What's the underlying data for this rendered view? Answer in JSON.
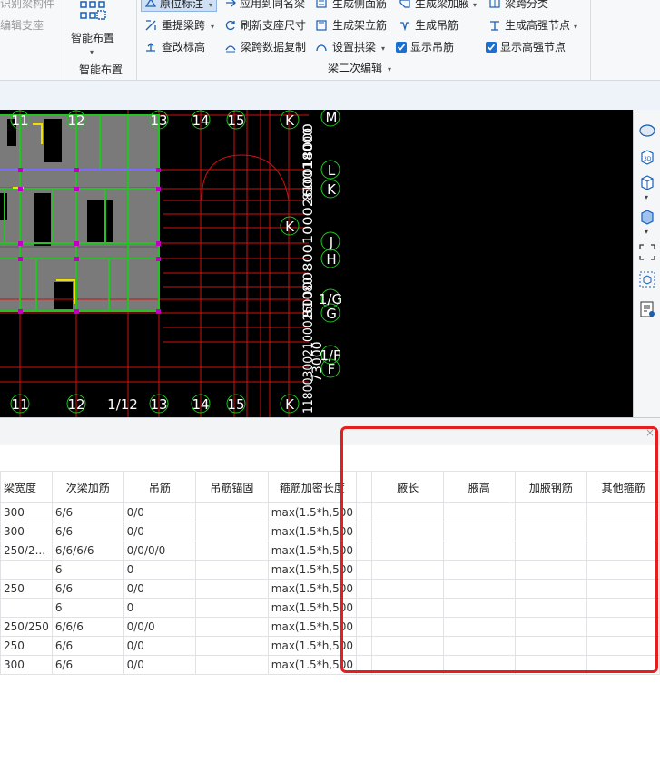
{
  "ribbon": {
    "left_items": [
      "识别梁构件",
      "编辑支座"
    ],
    "smart_layout_btn": "智能布置",
    "smart_layout_group": "智能布置",
    "tools": [
      {
        "label": "原位标注",
        "icon": "origin-annotation-icon",
        "dropdown": true,
        "selected": true
      },
      {
        "label": "应用到同名梁",
        "icon": "apply-same-beam-icon",
        "dropdown": false
      },
      {
        "label": "生成侧面筋",
        "icon": "side-rebar-icon",
        "dropdown": false
      },
      {
        "label": "生成梁加腋",
        "icon": "beam-haunch-icon",
        "dropdown": true
      },
      {
        "label": "梁跨分类",
        "icon": "span-classify-icon",
        "dropdown": false
      },
      {
        "label": "重提梁跨",
        "icon": "re-extract-span-icon",
        "dropdown": true
      },
      {
        "label": "刷新支座尺寸",
        "icon": "refresh-support-icon",
        "dropdown": false
      },
      {
        "label": "生成架立筋",
        "icon": "erection-rebar-icon",
        "dropdown": false
      },
      {
        "label": "生成吊筋",
        "icon": "hanger-rebar-icon",
        "dropdown": false
      },
      {
        "label": "生成高强节点",
        "icon": "high-strength-node-icon",
        "dropdown": true
      },
      {
        "label": "查改标高",
        "icon": "elevation-icon",
        "dropdown": false
      },
      {
        "label": "梁跨数据复制",
        "icon": "span-copy-icon",
        "dropdown": false
      },
      {
        "label": "设置拱梁",
        "icon": "arch-beam-icon",
        "dropdown": true
      }
    ],
    "checkboxes": [
      {
        "label": "显示吊筋",
        "checked": true
      },
      {
        "label": "显示高强节点",
        "checked": true
      }
    ],
    "group_label": "梁二次编辑"
  },
  "cad": {
    "top_axes": [
      "11",
      "12",
      "13",
      "14",
      "15",
      "K"
    ],
    "bottom_axes": [
      "11",
      "12",
      "1/12",
      "13",
      "14",
      "15",
      "K"
    ],
    "right_axes": [
      "M",
      "L",
      "K",
      "J",
      "H",
      "1/G",
      "G",
      "1/F",
      "F"
    ],
    "vertical_dims": [
      "810014000",
      "810008001000260018000",
      "1180030021000260080",
      "73000"
    ],
    "colors": {
      "grid": "#d01010",
      "beam": "#22c322",
      "wall": "#7a7a7a",
      "node": "#c000c0",
      "axis_text": "#ffffff",
      "bubble": "#22c322",
      "accent": "#f0e000"
    }
  },
  "view_tools": [
    "orbit-icon",
    "3d-view-icon",
    "top-view-icon",
    "solid-view-icon",
    "fit-view-icon",
    "select-box-icon",
    "properties-icon"
  ],
  "panel": {
    "close_glyph": "×",
    "columns": [
      "梁宽度",
      "次梁加筋",
      "吊筋",
      "吊筋锚固",
      "箍筋加密长度",
      "",
      "腋长",
      "腋高",
      "加腋钢筋",
      "其他箍筋"
    ],
    "rows": [
      [
        "300",
        "6/6",
        "0/0",
        "",
        "max(1.5*h,500",
        "",
        "",
        "",
        "",
        ""
      ],
      [
        "300",
        "6/6",
        "0/0",
        "",
        "max(1.5*h,500",
        "",
        "",
        "",
        "",
        ""
      ],
      [
        "250/2...",
        "6/6/6/6",
        "0/0/0/0",
        "",
        "max(1.5*h,500",
        "",
        "",
        "",
        "",
        ""
      ],
      [
        "",
        "6",
        "0",
        "",
        "max(1.5*h,500",
        "",
        "",
        "",
        "",
        ""
      ],
      [
        "250",
        "6/6",
        "0/0",
        "",
        "max(1.5*h,500",
        "",
        "",
        "",
        "",
        ""
      ],
      [
        "",
        "6",
        "0",
        "",
        "max(1.5*h,500",
        "",
        "",
        "",
        "",
        ""
      ],
      [
        "250/250",
        "6/6/6",
        "0/0/0",
        "",
        "max(1.5*h,500",
        "",
        "",
        "",
        "",
        ""
      ],
      [
        "250",
        "6/6",
        "0/0",
        "",
        "max(1.5*h,500",
        "",
        "",
        "",
        "",
        ""
      ],
      [
        "300",
        "6/6",
        "0/0",
        "",
        "max(1.5*h,500",
        "",
        "",
        "",
        "",
        ""
      ]
    ]
  }
}
